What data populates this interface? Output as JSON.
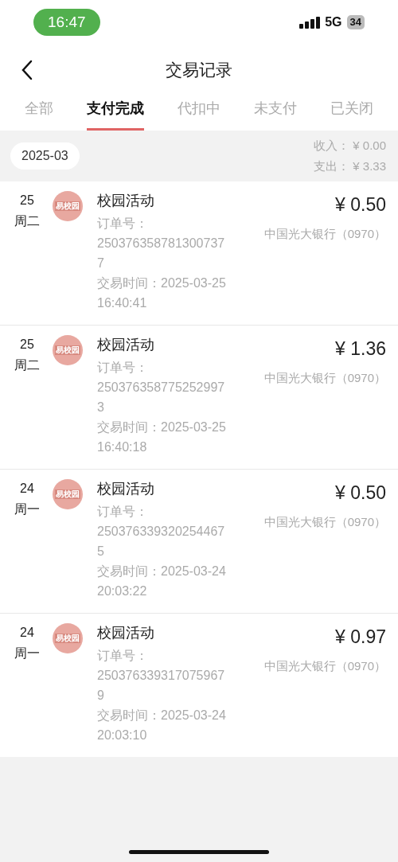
{
  "status_bar": {
    "time": "16:47",
    "network": "5G",
    "battery": "34"
  },
  "header": {
    "title": "交易记录"
  },
  "tabs": [
    {
      "label": "全部",
      "selected": false
    },
    {
      "label": "支付完成",
      "selected": true
    },
    {
      "label": "代扣中",
      "selected": false
    },
    {
      "label": "未支付",
      "selected": false
    },
    {
      "label": "已关闭",
      "selected": false
    }
  ],
  "summary": {
    "month": "2025-03",
    "income": "收入： ¥ 0.00",
    "expense": "支出： ¥ 3.33"
  },
  "transactions": [
    {
      "day": "25",
      "weekday": "周二",
      "logo_text": "易校园",
      "title": "校园活动",
      "order_label": "订单号：",
      "order_number": "2503763587813007377",
      "time_label": "交易时间：",
      "time": "2025-03-25 16:40:41",
      "amount": "¥ 0.50",
      "bank": "中国光大银行（0970）"
    },
    {
      "day": "25",
      "weekday": "周二",
      "logo_text": "易校园",
      "title": "校园活动",
      "order_label": "订单号：",
      "order_number": "2503763587752529973",
      "time_label": "交易时间：",
      "time": "2025-03-25 16:40:18",
      "amount": "¥ 1.36",
      "bank": "中国光大银行（0970）"
    },
    {
      "day": "24",
      "weekday": "周一",
      "logo_text": "易校园",
      "title": "校园活动",
      "order_label": "订单号：",
      "order_number": "2503763393202544675",
      "time_label": "交易时间：",
      "time": "2025-03-24 20:03:22",
      "amount": "¥ 0.50",
      "bank": "中国光大银行（0970）"
    },
    {
      "day": "24",
      "weekday": "周一",
      "logo_text": "易校园",
      "title": "校园活动",
      "order_label": "订单号：",
      "order_number": "2503763393170759679",
      "time_label": "交易时间：",
      "time": "2025-03-24 20:03:10",
      "amount": "¥ 0.97",
      "bank": "中国光大银行（0970）"
    }
  ]
}
